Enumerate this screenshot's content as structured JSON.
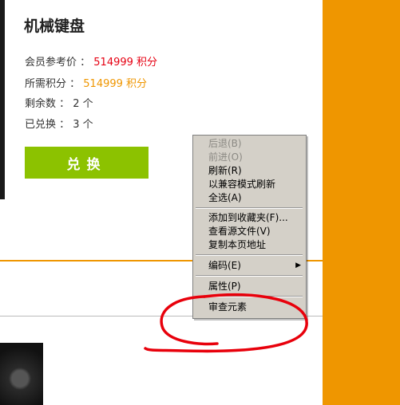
{
  "product": {
    "title": "机械键盘",
    "member_price_label": "会员参考价 ：",
    "member_price_value": "514999 积分",
    "points_label": "所需积分 ：",
    "points_value": "514999 积分",
    "remaining_label": "剩余数 ：",
    "remaining_value": "2 个",
    "redeemed_label": "已兑换 ：",
    "redeemed_value": "3 个",
    "redeem_button": "兑换"
  },
  "context_menu": {
    "items": [
      {
        "label": "后退(B)",
        "enabled": false
      },
      {
        "label": "前进(O)",
        "enabled": false
      },
      {
        "label": "刷新(R)",
        "enabled": true
      },
      {
        "label": "以兼容模式刷新",
        "enabled": true
      },
      {
        "label": "全选(A)",
        "enabled": true
      },
      {
        "label": "添加到收藏夹(F)...",
        "enabled": true
      },
      {
        "label": "查看源文件(V)",
        "enabled": true
      },
      {
        "label": "复制本页地址",
        "enabled": true
      },
      {
        "label": "编码(E)",
        "enabled": true,
        "submenu_icon": "chevron-right-icon"
      },
      {
        "label": "属性(P)",
        "enabled": true
      },
      {
        "label": "审查元素",
        "enabled": true
      }
    ]
  },
  "colors": {
    "accent_orange": "#ef9600",
    "price_red": "#e60012",
    "button_green": "#8cc200",
    "menu_bg": "#d4d0c8",
    "annotation_red": "#e8000b"
  }
}
